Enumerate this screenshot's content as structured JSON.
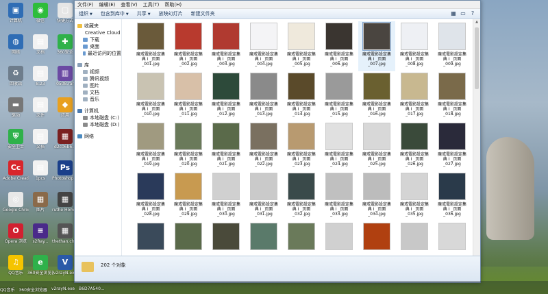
{
  "desktop": {
    "icons": [
      {
        "label": "计算机",
        "color": "#2f6db5",
        "glyph": "▣"
      },
      {
        "label": "微信",
        "color": "#2ebd3b",
        "glyph": "◉"
      },
      {
        "label": "快捷方式",
        "color": "#e6e6e6",
        "glyph": "▢"
      },
      {
        "label": "网络",
        "color": "#2f6db5",
        "glyph": "◍"
      },
      {
        "label": "文档",
        "color": "#f2f2f2",
        "glyph": "▤"
      },
      {
        "label": "360安全",
        "color": "#2fb14a",
        "glyph": "✚"
      },
      {
        "label": "回收站",
        "color": "#6e7d8c",
        "glyph": "♻"
      },
      {
        "label": "8.23",
        "color": "#f2f2f2",
        "glyph": "▤"
      },
      {
        "label": "0508.rar",
        "color": "#6b4aa3",
        "glyph": "▥"
      },
      {
        "label": "驱动",
        "color": "#777",
        "glyph": "▬"
      },
      {
        "label": "文件",
        "color": "#f2f2f2",
        "glyph": "▤"
      },
      {
        "label": "应用",
        "color": "#e8a020",
        "glyph": "◆"
      },
      {
        "label": "安全卫士",
        "color": "#2fb14a",
        "glyph": "⛨"
      },
      {
        "label": "文档",
        "color": "#f2f2f2",
        "glyph": "▤"
      },
      {
        "label": "d2c06b6...",
        "color": "#7a2020",
        "glyph": "▦"
      },
      {
        "label": "Adobe Creati...",
        "color": "#d8262c",
        "glyph": "Cc"
      },
      {
        "label": "1pcs",
        "color": "#f2f2f2",
        "glyph": "▤"
      },
      {
        "label": "Photoshop CS6",
        "color": "#1b3f8a",
        "glyph": "Ps"
      },
      {
        "label": "Google Chrome",
        "color": "#e8e8e8",
        "glyph": "◎"
      },
      {
        "label": "图片",
        "color": "#8a6a4a",
        "glyph": "▦"
      },
      {
        "label": "ruthe Home...",
        "color": "#444",
        "glyph": "▦"
      },
      {
        "label": "Opera 浏览",
        "color": "#d12030",
        "glyph": "O"
      },
      {
        "label": "s2Ray...",
        "color": "#4a2a8a",
        "glyph": "≡"
      },
      {
        "label": "thethan.chi...",
        "color": "#555",
        "glyph": "▦"
      },
      {
        "label": "QQ音乐",
        "color": "#f5c400",
        "glyph": "♫"
      },
      {
        "label": "360安全浏览器",
        "color": "#2fb14a",
        "glyph": "e"
      },
      {
        "label": "v2rayN.exe",
        "color": "#2a5aa8",
        "glyph": "V"
      }
    ],
    "taskbar_labels": [
      "QQ音乐",
      "360安全浏览器",
      "v2rayN.exe",
      "B6D7A540..."
    ]
  },
  "window": {
    "menu": [
      "文件(F)",
      "编辑(E)",
      "查看(V)",
      "工具(T)",
      "帮助(H)"
    ],
    "toolbar": [
      "组织",
      "包含到库中",
      "共享",
      "放映幻灯片",
      "新建文件夹"
    ],
    "nav": {
      "favorites_title": "收藏夹",
      "favorites": [
        "Creative Cloud File",
        "下载",
        "桌面",
        "最近访问的位置"
      ],
      "libraries_title": "库",
      "libraries": [
        "视频",
        "腾讯视频",
        "图片",
        "文档",
        "音乐"
      ],
      "computer_title": "计算机",
      "computer": [
        "本地磁盘 (C:)",
        "本地磁盘 (D:)"
      ],
      "network_title": "网络"
    },
    "files": [
      {
        "l1": "魔戒電影設定集",
        "l2": "典 I _页面",
        "l3": "_001.jpg",
        "c": "#6a5a3a"
      },
      {
        "l1": "魔戒電影設定集",
        "l2": "典 I _页面",
        "l3": "_002.jpg",
        "c": "#b83a2e"
      },
      {
        "l1": "魔戒電影設定集",
        "l2": "典 I _页面",
        "l3": "_003.jpg",
        "c": "#b03a30"
      },
      {
        "l1": "魔戒電影設定集",
        "l2": "典 I _页面",
        "l3": "_004.jpg",
        "c": "#f4f4f6"
      },
      {
        "l1": "魔戒電影設定集",
        "l2": "典 I _页面",
        "l3": "_005.jpg",
        "c": "#efe9dc"
      },
      {
        "l1": "魔戒電影設定集",
        "l2": "典 I _页面",
        "l3": "_006.jpg",
        "c": "#3a3530"
      },
      {
        "l1": "魔戒電影設定集",
        "l2": "典 I _页面",
        "l3": "_007.jpg",
        "c": "#4a4540"
      },
      {
        "l1": "魔戒電影設定集",
        "l2": "典 I _页面",
        "l3": "_008.jpg",
        "c": "#eef0f4"
      },
      {
        "l1": "魔戒電影設定集",
        "l2": "典 I _页面",
        "l3": "_009.jpg",
        "c": "#dfe4ea"
      },
      {
        "l1": "魔戒電影設定集",
        "l2": "典 I _页面",
        "l3": "_010.jpg",
        "c": "#c9c3b2"
      },
      {
        "l1": "魔戒電影設定集",
        "l2": "典 I _页面",
        "l3": "_011.jpg",
        "c": "#d8c0a8"
      },
      {
        "l1": "魔戒電影設定集",
        "l2": "典 I _页面",
        "l3": "_012.jpg",
        "c": "#2d4a3a"
      },
      {
        "l1": "魔戒電影設定集",
        "l2": "典 I _页面",
        "l3": "_013.jpg",
        "c": "#8a8a8a"
      },
      {
        "l1": "魔戒電影設定集",
        "l2": "典 I _页面",
        "l3": "_014.jpg",
        "c": "#5a4a2a"
      },
      {
        "l1": "魔戒電影設定集",
        "l2": "典 I _页面",
        "l3": "_015.jpg",
        "c": "#9a9a9a"
      },
      {
        "l1": "魔戒電影設定集",
        "l2": "典 I _页面",
        "l3": "_016.jpg",
        "c": "#6a6030"
      },
      {
        "l1": "魔戒電影設定集",
        "l2": "典 I _页面",
        "l3": "_017.jpg",
        "c": "#c8b890"
      },
      {
        "l1": "魔戒電影設定集",
        "l2": "典 I _页面",
        "l3": "_018.jpg",
        "c": "#7a6a4a"
      },
      {
        "l1": "魔戒電影設定集",
        "l2": "典 I _页面",
        "l3": "_019.jpg",
        "c": "#a09a80"
      },
      {
        "l1": "魔戒電影設定集",
        "l2": "典 I _页面",
        "l3": "_020.jpg",
        "c": "#6a7a5a"
      },
      {
        "l1": "魔戒電影設定集",
        "l2": "典 I _页面",
        "l3": "_021.jpg",
        "c": "#5a6a4a"
      },
      {
        "l1": "魔戒電影設定集",
        "l2": "典 I _页面",
        "l3": "_022.jpg",
        "c": "#7a7060"
      },
      {
        "l1": "魔戒電影設定集",
        "l2": "典 I _页面",
        "l3": "_023.jpg",
        "c": "#b89a70"
      },
      {
        "l1": "魔戒電影設定集",
        "l2": "典 I _页面",
        "l3": "_024.jpg",
        "c": "#e0e0e0"
      },
      {
        "l1": "魔戒電影設定集",
        "l2": "典 I _页面",
        "l3": "_025.jpg",
        "c": "#d8d8d8"
      },
      {
        "l1": "魔戒電影設定集",
        "l2": "典 I _页面",
        "l3": "_026.jpg",
        "c": "#3a4a3a"
      },
      {
        "l1": "魔戒電影設定集",
        "l2": "典 I _页面",
        "l3": "_027.jpg",
        "c": "#2a2a3a"
      },
      {
        "l1": "魔戒電影設定集",
        "l2": "典 I _页面",
        "l3": "_028.jpg",
        "c": "#2a3a5a"
      },
      {
        "l1": "魔戒電影設定集",
        "l2": "典 I _页面",
        "l3": "_029.jpg",
        "c": "#c89a50"
      },
      {
        "l1": "魔戒電影設定集",
        "l2": "典 I _页面",
        "l3": "_030.jpg",
        "c": "#d0d0d0"
      },
      {
        "l1": "魔戒電影設定集",
        "l2": "典 I _页面",
        "l3": "_031.jpg",
        "c": "#cacaca"
      },
      {
        "l1": "魔戒電影設定集",
        "l2": "典 I _页面",
        "l3": "_032.jpg",
        "c": "#3a4a4a"
      },
      {
        "l1": "魔戒電影設定集",
        "l2": "典 I _页面",
        "l3": "_033.jpg",
        "c": "#c0c0c0"
      },
      {
        "l1": "魔戒電影設定集",
        "l2": "典 I _页面",
        "l3": "_034.jpg",
        "c": "#bcbcbc"
      },
      {
        "l1": "魔戒電影設定集",
        "l2": "典 I _页面",
        "l3": "_035.jpg",
        "c": "#d4d4d4"
      },
      {
        "l1": "魔戒電影設定集",
        "l2": "典 I _页面",
        "l3": "_036.jpg",
        "c": "#2a3a4a"
      },
      {
        "l1": "",
        "l2": "",
        "l3": "",
        "c": "#3a4a5a"
      },
      {
        "l1": "",
        "l2": "",
        "l3": "",
        "c": "#5a6a4a"
      },
      {
        "l1": "",
        "l2": "",
        "l3": "",
        "c": "#4a4a3a"
      },
      {
        "l1": "",
        "l2": "",
        "l3": "",
        "c": "#5a7a6a"
      },
      {
        "l1": "",
        "l2": "",
        "l3": "",
        "c": "#6a7a5a"
      },
      {
        "l1": "",
        "l2": "",
        "l3": "",
        "c": "#d0d0d0"
      },
      {
        "l1": "",
        "l2": "",
        "l3": "",
        "c": "#b04010"
      },
      {
        "l1": "",
        "l2": "",
        "l3": "",
        "c": "#c8c8c8"
      },
      {
        "l1": "",
        "l2": "",
        "l3": "",
        "c": "#d8d8d8"
      }
    ],
    "status_count": "202 个对象"
  }
}
